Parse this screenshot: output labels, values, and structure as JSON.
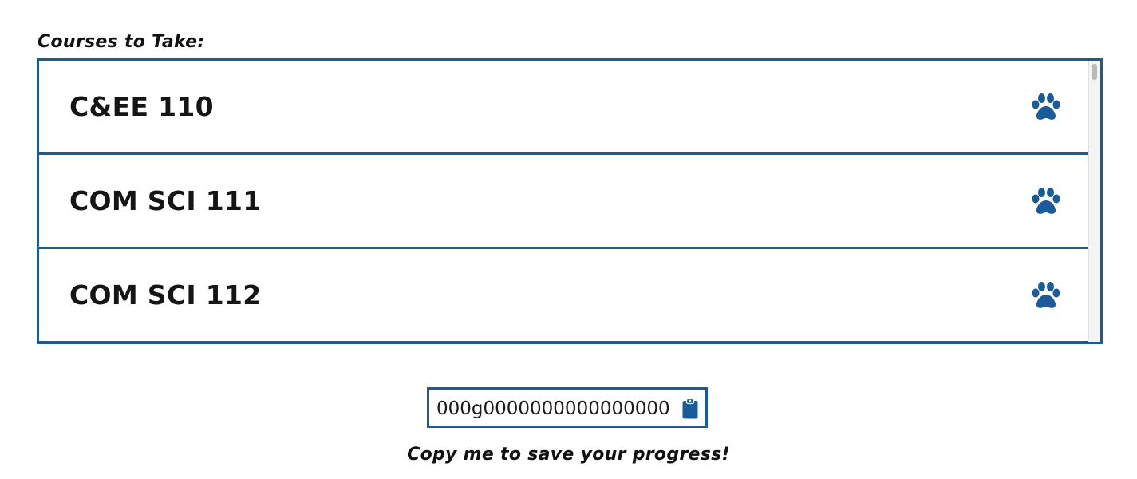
{
  "section": {
    "title": "Courses to Take:"
  },
  "courses": [
    {
      "label": "C&EE 110",
      "icon": "paw-icon"
    },
    {
      "label": "COM SCI 111",
      "icon": "paw-icon"
    },
    {
      "label": "COM SCI 112",
      "icon": "paw-icon"
    }
  ],
  "progress_code": {
    "value": "000g0000000000000000",
    "copy_icon": "clipboard-icon",
    "hint": "Copy me to save your progress!"
  },
  "colors": {
    "accent": "#1b5b9a",
    "text": "#151515",
    "background": "#ffffff"
  }
}
